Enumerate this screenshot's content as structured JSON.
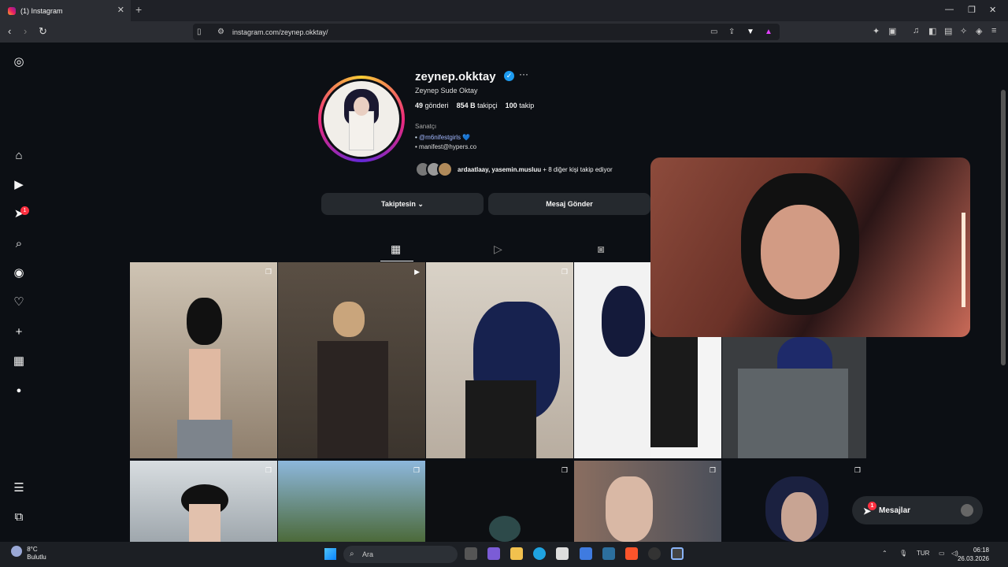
{
  "browser": {
    "tab_title": "(1) Instagram",
    "url": "instagram.com/zeynep.okktay/"
  },
  "sidebar": {
    "notification_count": "1"
  },
  "profile": {
    "username": "zeynep.okktay",
    "full_name": "Zeynep Sude Oktay",
    "posts_count": "49",
    "posts_label": "gönderi",
    "followers_count": "854 B",
    "followers_label": "takipçi",
    "following_count": "100",
    "following_label": "takip",
    "category": "Sanatçı",
    "bio_link_prefix": "• ",
    "bio_link": "@m6nifestgirls",
    "bio_heart": "💙",
    "bio_email": "• manifest@hypers.co",
    "mutual_names": "ardaatlaay, yasemin.musluu",
    "mutual_suffix": "+ 8 diğer kişi takip ediyor"
  },
  "actions": {
    "following_button": "Takiptesin",
    "message_button": "Mesaj Gönder"
  },
  "messages": {
    "label": "Mesajlar",
    "count": "1"
  },
  "taskbar": {
    "weather_temp": "8°C",
    "weather_desc": "Bulutlu",
    "search_placeholder": "Ara",
    "language": "TUR",
    "time": "06:18",
    "date": "26.03.2026"
  }
}
